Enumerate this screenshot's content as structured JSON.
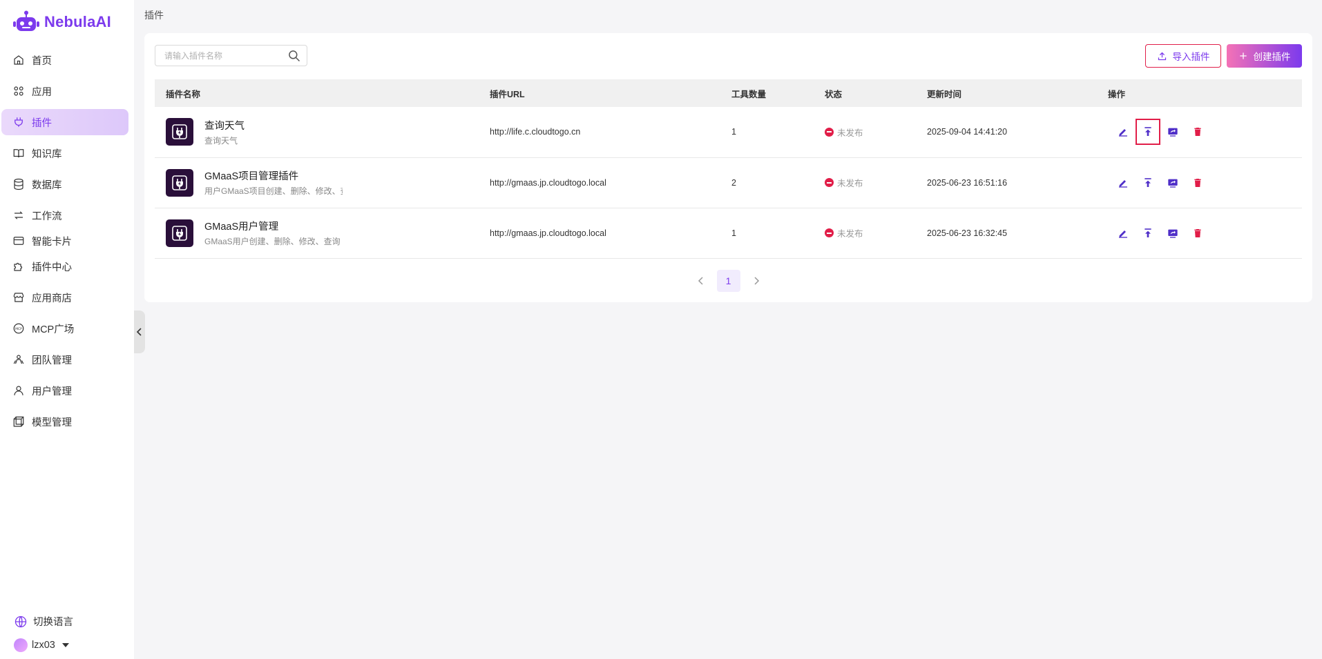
{
  "brand": {
    "name": "NebulaAI",
    "color": "#7c3aed"
  },
  "sidebar": {
    "items": [
      {
        "label": "首页",
        "icon": "home-icon"
      },
      {
        "label": "应用",
        "icon": "apps-icon"
      },
      {
        "label": "插件",
        "icon": "plug-icon",
        "active": true
      },
      {
        "label": "知识库",
        "icon": "book-icon"
      },
      {
        "label": "数据库",
        "icon": "database-icon"
      },
      {
        "label": "工作流",
        "icon": "workflow-icon"
      },
      {
        "label": "智能卡片",
        "icon": "card-icon"
      },
      {
        "label": "插件中心",
        "icon": "puzzle-icon"
      },
      {
        "label": "应用商店",
        "icon": "store-icon"
      },
      {
        "label": "MCP广场",
        "icon": "mcp-icon"
      },
      {
        "label": "团队管理",
        "icon": "team-icon"
      },
      {
        "label": "用户管理",
        "icon": "user-icon"
      },
      {
        "label": "模型管理",
        "icon": "model-icon"
      }
    ],
    "language_label": "切换语言",
    "username": "lzx03"
  },
  "breadcrumb": "插件",
  "search": {
    "placeholder": "请输入插件名称",
    "value": ""
  },
  "toolbar": {
    "import_label": "导入插件",
    "create_label": "创建插件"
  },
  "table": {
    "headers": {
      "name": "插件名称",
      "url": "插件URL",
      "tools": "工具数量",
      "status": "状态",
      "updated": "更新时间",
      "ops": "操作"
    },
    "rows": [
      {
        "title": "查询天气",
        "desc": "查询天气",
        "url": "http://life.c.cloudtogo.cn",
        "tools": "1",
        "status": "未发布",
        "updated": "2025-09-04 14:41:20"
      },
      {
        "title": "GMaaS项目管理插件",
        "desc": "用户GMaaS项目创建、删除、修改、查询",
        "url": "http://gmaas.jp.cloudtogo.local",
        "tools": "2",
        "status": "未发布",
        "updated": "2025-06-23 16:51:16"
      },
      {
        "title": "GMaaS用户管理",
        "desc": "GMaaS用户创建、删除、修改、查询",
        "url": "http://gmaas.jp.cloudtogo.local",
        "tools": "1",
        "status": "未发布",
        "updated": "2025-06-23 16:32:45"
      }
    ]
  },
  "pagination": {
    "current": "1"
  },
  "colors": {
    "accent": "#7c3aed",
    "danger": "#e11d48",
    "status_unpublished": "#e11d48"
  }
}
